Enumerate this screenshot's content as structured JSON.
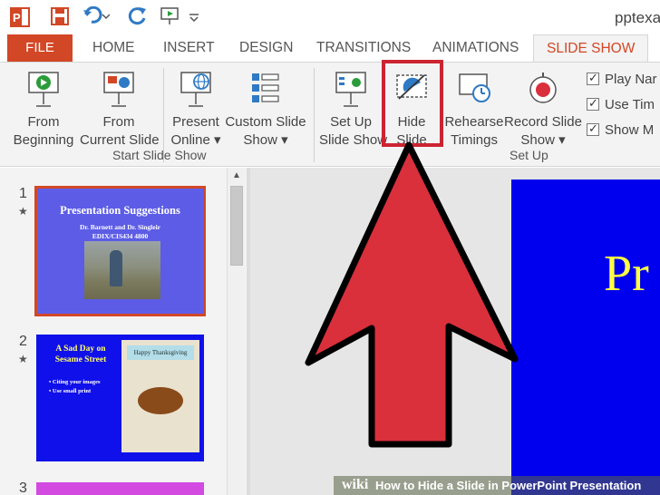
{
  "app": {
    "filename": "pptexa"
  },
  "tabs": {
    "file": "FILE",
    "home": "HOME",
    "insert": "INSERT",
    "design": "DESIGN",
    "transitions": "TRANSITIONS",
    "animations": "ANIMATIONS",
    "slideshow": "SLIDE SHOW"
  },
  "ribbon": {
    "from_beginning": [
      "From",
      "Beginning"
    ],
    "from_current": [
      "From",
      "Current Slide"
    ],
    "present_online": [
      "Present",
      "Online ▾"
    ],
    "custom_show": [
      "Custom Slide",
      "Show ▾"
    ],
    "group_start": "Start Slide Show",
    "setup_show": [
      "Set Up",
      "Slide Show"
    ],
    "hide_slide": [
      "Hide",
      "Slide"
    ],
    "rehearse": [
      "Rehearse",
      "Timings"
    ],
    "record": [
      "Record Slide",
      "Show ▾"
    ],
    "group_setup": "Set Up",
    "checks": [
      "Play Nar",
      "Use Tim",
      "Show M"
    ]
  },
  "slides": {
    "s1": {
      "number": "1",
      "title": "Presentation Suggestions",
      "sub1": "Dr. Barnett and Dr. Singleir",
      "sub2": "EDIX/CIS434 4800"
    },
    "s2": {
      "number": "2",
      "title": "A Sad Day on Sesame Street",
      "bullets": [
        "Citing your images",
        "Use small print"
      ],
      "banner": "Happy Thanksgiving"
    },
    "s3": {
      "number": "3"
    },
    "main_title": "Pr"
  },
  "watermark": {
    "wiki": "wiki",
    "title": "How to Hide a Slide in PowerPoint Presentation"
  },
  "colors": {
    "accent": "#d24726",
    "highlight": "#cc2431",
    "arrow": "#d9303b",
    "slide_blue": "#0000ee"
  }
}
